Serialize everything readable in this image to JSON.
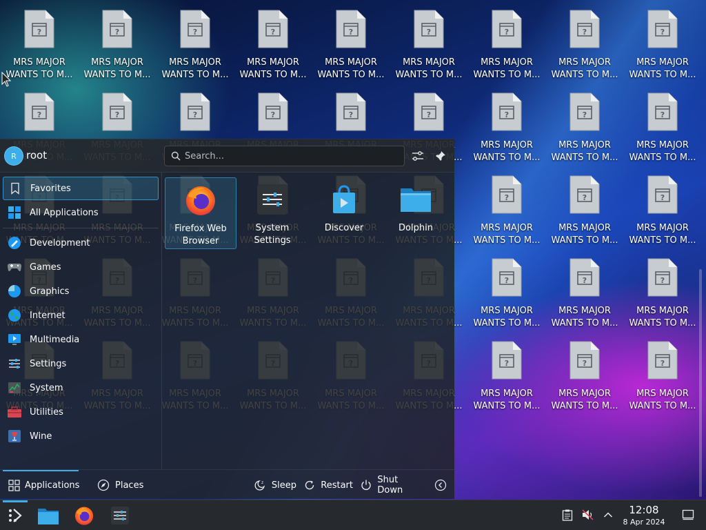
{
  "desktop": {
    "icon_label": "MRS MAJOR\nWANTS TO M...",
    "icon_name": "unknown-file-icon"
  },
  "launcher": {
    "user": {
      "initial": "R",
      "name": "root"
    },
    "search": {
      "placeholder": "Search...",
      "value": ""
    },
    "categories": [
      {
        "label": "Favorites",
        "icon": "bookmark-icon",
        "selected": true
      },
      {
        "label": "All Applications",
        "icon": "grid-icon"
      },
      {
        "label": "Development",
        "icon": "development-icon"
      },
      {
        "label": "Games",
        "icon": "gamepad-icon"
      },
      {
        "label": "Graphics",
        "icon": "graphics-icon"
      },
      {
        "label": "Internet",
        "icon": "globe-icon"
      },
      {
        "label": "Multimedia",
        "icon": "multimedia-icon"
      },
      {
        "label": "Settings",
        "icon": "settings-icon"
      },
      {
        "label": "System",
        "icon": "system-icon"
      },
      {
        "label": "Utilities",
        "icon": "toolbox-icon"
      },
      {
        "label": "Wine",
        "icon": "wine-glass-icon"
      }
    ],
    "apps": [
      {
        "label": "Firefox Web\nBrowser",
        "icon": "firefox-icon",
        "selected": true
      },
      {
        "label": "System\nSettings",
        "icon": "settings-sliders-icon"
      },
      {
        "label": "Discover",
        "icon": "shopping-bag-icon"
      },
      {
        "label": "Dolphin",
        "icon": "folder-icon"
      }
    ],
    "footer": {
      "applications": "Applications",
      "places": "Places",
      "sleep": "Sleep",
      "restart": "Restart",
      "shutdown": "Shut Down"
    }
  },
  "taskbar": {
    "time": "12:08",
    "date": "8 Apr 2024"
  },
  "colors": {
    "accent": "#3daee9",
    "panel": "#262a2f"
  }
}
